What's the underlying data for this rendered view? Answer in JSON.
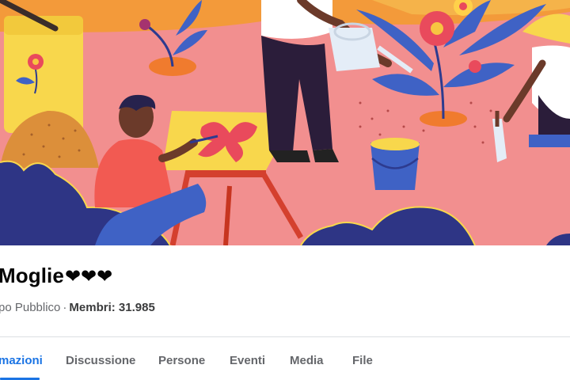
{
  "group": {
    "title": "Moglie",
    "title_hearts": "❤❤❤",
    "privacy": "po Pubblico",
    "separator": "·",
    "members_label": "Membri: 31.985"
  },
  "tabs": [
    {
      "label": "mazioni",
      "active": true
    },
    {
      "label": "Discussione",
      "active": false
    },
    {
      "label": "Persone",
      "active": false
    },
    {
      "label": "Eventi",
      "active": false
    },
    {
      "label": "Media",
      "active": false
    },
    {
      "label": "File",
      "active": false
    }
  ],
  "colors": {
    "cover_background": "#f28f8f",
    "accent": "#1b74e4",
    "muted_text": "#65676b"
  }
}
